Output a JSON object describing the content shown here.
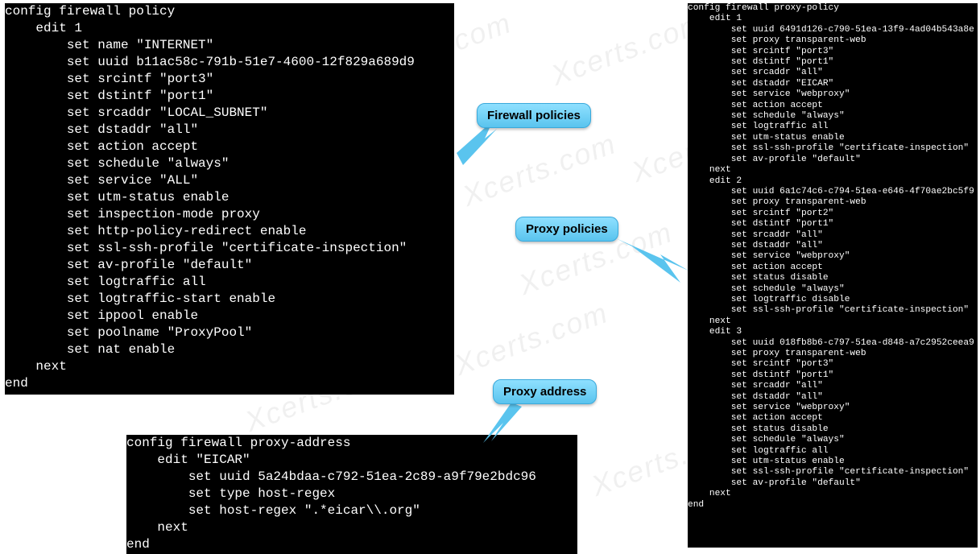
{
  "callouts": {
    "firewall": "Firewall policies",
    "proxy": "Proxy policies",
    "proxyaddr": "Proxy address"
  },
  "watermarks": [
    "Xcerts.com",
    "Xcerts.com",
    "Xcerts.com",
    "Xcerts.com",
    "Xcerts.com",
    "Xcerts.com",
    "Xcerts.com",
    "Xcerts.com",
    "Xcerts.com",
    "Xcerts.com",
    "Xcerts.com",
    "Xcerts.com"
  ],
  "firewall_policy": {
    "header": "config firewall policy",
    "edit": "    edit 1",
    "lines": [
      "        set name \"INTERNET\"",
      "        set uuid b11ac58c-791b-51e7-4600-12f829a689d9",
      "        set srcintf \"port3\"",
      "        set dstintf \"port1\"",
      "        set srcaddr \"LOCAL_SUBNET\"",
      "        set dstaddr \"all\"",
      "        set action accept",
      "        set schedule \"always\"",
      "        set service \"ALL\"",
      "        set utm-status enable",
      "        set inspection-mode proxy",
      "        set http-policy-redirect enable",
      "        set ssl-ssh-profile \"certificate-inspection\"",
      "        set av-profile \"default\"",
      "        set logtraffic all",
      "        set logtraffic-start enable",
      "        set ippool enable",
      "        set poolname \"ProxyPool\"",
      "        set nat enable"
    ],
    "next": "    next",
    "end": "end"
  },
  "proxy_address": {
    "header": "config firewall proxy-address",
    "edit": "    edit \"EICAR\"",
    "lines": [
      "        set uuid 5a24bdaa-c792-51ea-2c89-a9f79e2bdc96",
      "        set type host-regex",
      "        set host-regex \".*eicar\\\\.org\""
    ],
    "next": "    next",
    "end": "end"
  },
  "proxy_policy": {
    "header": "config firewall proxy-policy",
    "edits": [
      {
        "edit": "    edit 1",
        "lines": [
          "        set uuid 6491d126-c790-51ea-13f9-4ad04b543a8e",
          "        set proxy transparent-web",
          "        set srcintf \"port3\"",
          "        set dstintf \"port1\"",
          "        set srcaddr \"all\"",
          "        set dstaddr \"EICAR\"",
          "        set service \"webproxy\"",
          "        set action accept",
          "        set schedule \"always\"",
          "        set logtraffic all",
          "        set utm-status enable",
          "        set ssl-ssh-profile \"certificate-inspection\"",
          "        set av-profile \"default\""
        ],
        "next": "    next"
      },
      {
        "edit": "    edit 2",
        "lines": [
          "        set uuid 6a1c74c6-c794-51ea-e646-4f70ae2bc5f9",
          "        set proxy transparent-web",
          "        set srcintf \"port2\"",
          "        set dstintf \"port1\"",
          "        set srcaddr \"all\"",
          "        set dstaddr \"all\"",
          "        set service \"webproxy\"",
          "        set action accept",
          "        set status disable",
          "        set schedule \"always\"",
          "        set logtraffic disable",
          "        set ssl-ssh-profile \"certificate-inspection\""
        ],
        "next": "    next"
      },
      {
        "edit": "    edit 3",
        "lines": [
          "        set uuid 018fb8b6-c797-51ea-d848-a7c2952ceea9",
          "        set proxy transparent-web",
          "        set srcintf \"port3\"",
          "        set dstintf \"port1\"",
          "        set srcaddr \"all\"",
          "        set dstaddr \"all\"",
          "        set service \"webproxy\"",
          "        set action accept",
          "        set status disable",
          "        set schedule \"always\"",
          "        set logtraffic all",
          "        set utm-status enable",
          "        set ssl-ssh-profile \"certificate-inspection\"",
          "        set av-profile \"default\""
        ],
        "next": "    next"
      }
    ],
    "end": "end"
  }
}
